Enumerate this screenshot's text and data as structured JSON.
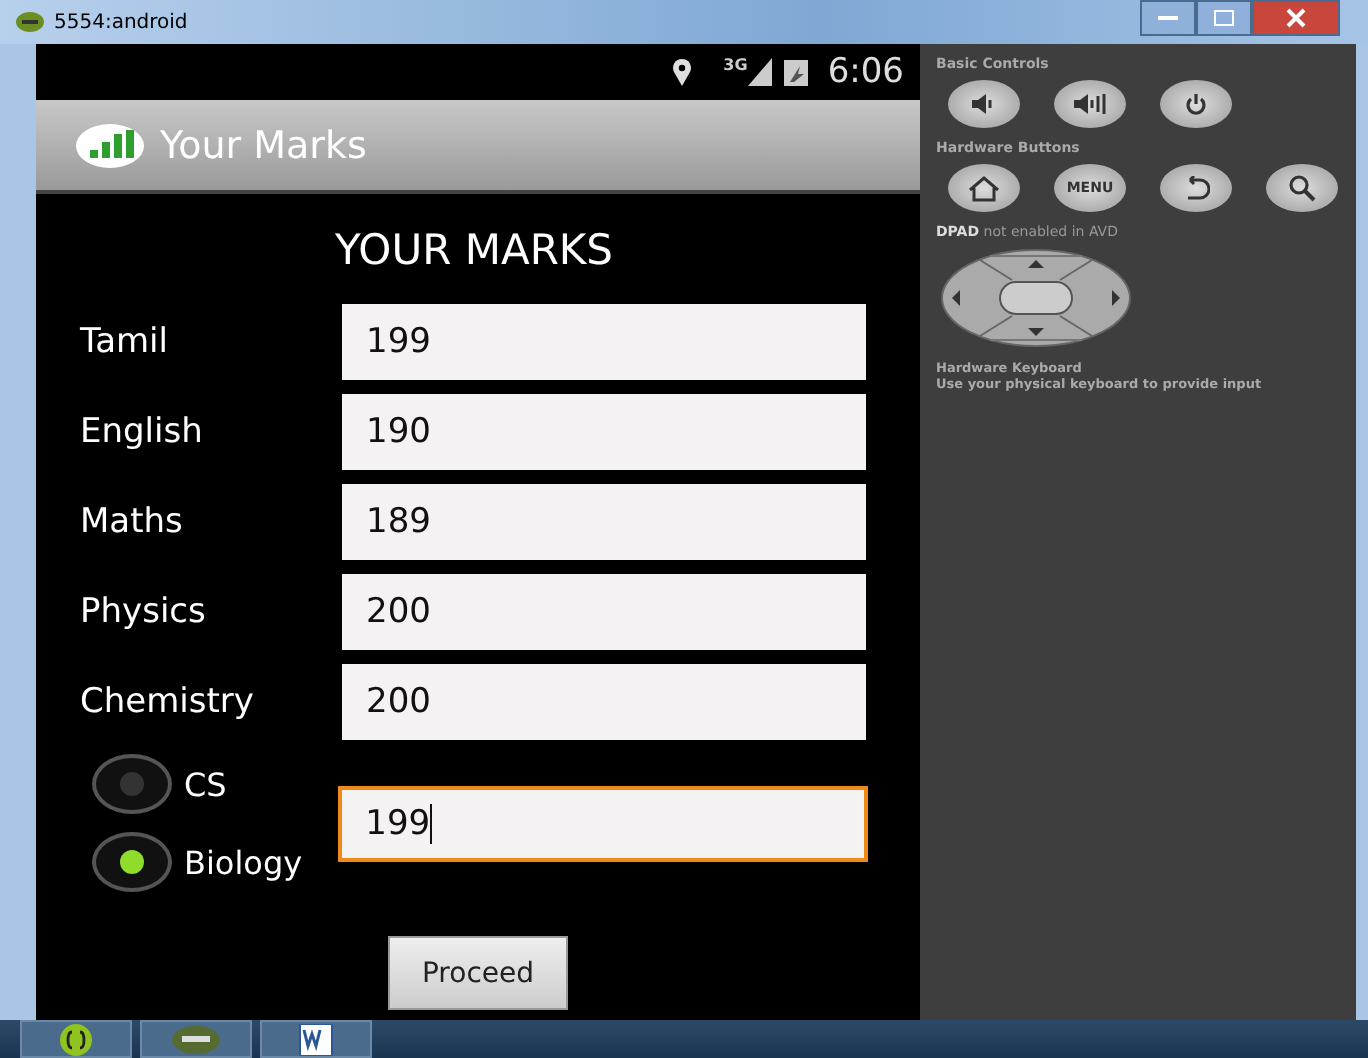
{
  "window": {
    "title": "5554:android"
  },
  "status_bar": {
    "network": "3G",
    "time": "6:06"
  },
  "action_bar": {
    "title": "Your Marks"
  },
  "heading": "YOUR MARKS",
  "subjects": [
    {
      "label": "Tamil",
      "value": "199"
    },
    {
      "label": "English",
      "value": "190"
    },
    {
      "label": "Maths",
      "value": "189"
    },
    {
      "label": "Physics",
      "value": "200"
    },
    {
      "label": "Chemistry",
      "value": "200"
    }
  ],
  "options": [
    {
      "label": "CS",
      "selected": false
    },
    {
      "label": "Biology",
      "selected": true
    }
  ],
  "option_field": {
    "value": "199",
    "focused": true
  },
  "proceed_button": "Proceed",
  "controls_panel": {
    "basic_controls": "Basic Controls",
    "hardware_buttons": "Hardware Buttons",
    "menu_key": "MENU",
    "dpad_note": "**DPAD** not enabled in AVD",
    "keyboard_title": "Hardware Keyboard",
    "keyboard_note": "Use your physical keyboard to provide input"
  }
}
